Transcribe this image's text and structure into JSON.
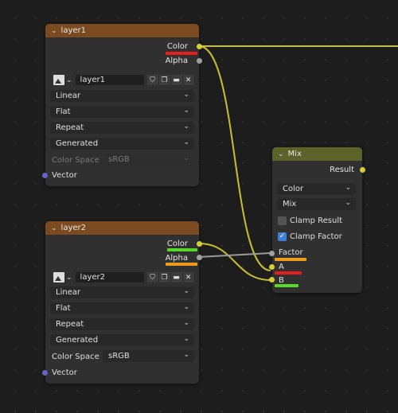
{
  "node_layer1": {
    "title": "layer1",
    "outputs": {
      "color": "Color",
      "alpha": "Alpha"
    },
    "image_name": "layer1",
    "interpolation": "Linear",
    "projection": "Flat",
    "extension": "Repeat",
    "source": "Generated",
    "color_space_label": "Color Space",
    "color_space_value": "sRGB",
    "input_vector": "Vector"
  },
  "node_layer2": {
    "title": "layer2",
    "outputs": {
      "color": "Color",
      "alpha": "Alpha"
    },
    "image_name": "layer2",
    "interpolation": "Linear",
    "projection": "Flat",
    "extension": "Repeat",
    "source": "Generated",
    "color_space_label": "Color Space",
    "color_space_value": "sRGB",
    "input_vector": "Vector"
  },
  "node_mix": {
    "title": "Mix",
    "output_result": "Result",
    "data_type": "Color",
    "blend_mode": "Mix",
    "clamp_result": {
      "label": "Clamp Result",
      "checked": false
    },
    "clamp_factor": {
      "label": "Clamp Factor",
      "checked": true
    },
    "input_factor": "Factor",
    "input_a": "A",
    "input_b": "B"
  },
  "icons": {
    "collapse": "chevron-down-icon",
    "image": "image-icon",
    "fake_user": "shield-icon",
    "duplicate": "duplicate-icon",
    "open": "folder-icon",
    "unlink": "close-icon"
  },
  "colors": {
    "image_header": "#7b4a20",
    "mix_header": "#5d622a",
    "socket_color": "#d8cf38",
    "socket_float": "#a0a0a0",
    "socket_vector": "#6363c7",
    "bar_red": "#e51f1f",
    "bar_green": "#5ad82a",
    "bar_orange": "#ef9a1a",
    "checkbox_on": "#3f7fd6"
  }
}
